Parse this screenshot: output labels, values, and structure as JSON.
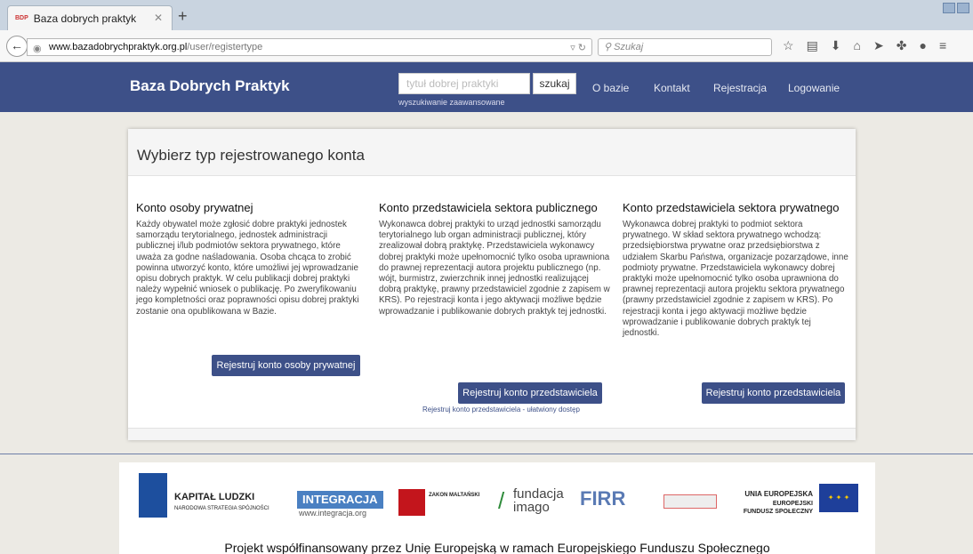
{
  "browser": {
    "tab_title": "Baza dobrych praktyk",
    "tab_favicon": "BDP",
    "url_host": "www.bazadobrychpraktyk.org.pl",
    "url_path": "/user/registertype",
    "search_placeholder": "Szukaj"
  },
  "header": {
    "brand": "Baza Dobrych Praktyk",
    "search_placeholder": "tytuł dobrej praktyki",
    "search_button": "szukaj",
    "advanced_search": "wyszukiwanie zaawansowane",
    "menu": [
      "O bazie",
      "Kontakt",
      "Rejestracja",
      "Logowanie"
    ],
    "color": "#3d5088"
  },
  "main": {
    "title": "Wybierz typ rejestrowanego konta",
    "columns": [
      {
        "heading": "Konto osoby prywatnej",
        "text": "Każdy obywatel może zgłosić dobre praktyki jednostek samorządu terytorialnego, jednostek administracji publicznej i/lub podmiotów sektora prywatnego, które uważa za godne naśladowania. Osoba chcąca to zrobić powinna utworzyć konto, które umożliwi jej wprowadzanie opisu dobrych praktyk. W celu publikacji dobrej praktyki należy wypełnić wniosek o publikację. Po zweryfikowaniu jego kompletności oraz poprawności opisu dobrej praktyki zostanie ona opublikowana w Bazie.",
        "button": "Rejestruj konto osoby prywatnej"
      },
      {
        "heading": "Konto przedstawiciela sektora publicznego",
        "text": "Wykonawca dobrej praktyki to urząd jednostki samorządu terytorialnego lub organ administracji publicznej, który zrealizował dobrą praktykę. Przedstawiciela wykonawcy dobrej praktyki może upełnomocnić tylko osoba uprawniona do prawnej reprezentacji autora projektu publicznego (np. wójt, burmistrz, zwierzchnik innej jednostki realizującej dobrą praktykę, prawny przedstawiciel zgodnie z zapisem w KRS). Po rejestracji konta i jego aktywacji możliwe będzie wprowadzanie i publikowanie dobrych praktyk tej jednostki.",
        "button": "Rejestruj konto przedstawiciela",
        "link": "Rejestruj konto przedstawiciela - ułatwiony dostęp"
      },
      {
        "heading": "Konto przedstawiciela sektora prywatnego",
        "text": "Wykonawca dobrej praktyki to podmiot sektora prywatnego. W skład sektora prywatnego wchodzą: przedsiębiorstwa prywatne oraz przedsiębiorstwa z udziałem Skarbu Państwa, organizacje pozarządowe, inne podmioty prywatne. Przedstawiciela wykonawcy dobrej praktyki może upełnomocnić tylko osoba uprawniona do prawnej reprezentacji autora projektu sektora prywatnego (prawny przedstawiciel zgodnie z zapisem w KRS). Po rejestracji konta i jego aktywacji możliwe będzie wprowadzanie i publikowanie dobrych praktyk tej jednostki.",
        "button": "Rejestruj konto przedstawiciela"
      }
    ]
  },
  "footer": {
    "logos": {
      "kl_title": "KAPITAŁ LUDZKI",
      "kl_sub": "NARODOWA STRATEGIA SPÓJNOŚCI",
      "integracja": "INTEGRACJA",
      "integracja_url": "www.integracja.org",
      "zakon": "ZAKON MALTAŃSKI",
      "fundacja": "fundacja",
      "imago": "imago",
      "firr": "FIRR",
      "ue_title": "UNIA EUROPEJSKA",
      "ue_sub1": "EUROPEJSKI",
      "ue_sub2": "FUNDUSZ SPOŁECZNY"
    },
    "funded_text": "Projekt współfinansowany przez Unię Europejską w ramach Europejskiego Funduszu Społecznego"
  }
}
